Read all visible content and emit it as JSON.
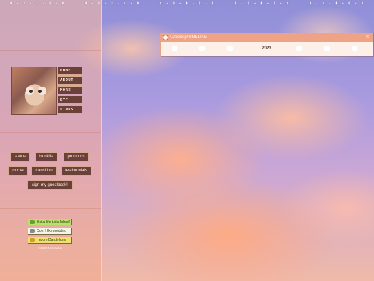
{
  "top_strip": {
    "glyphs": "✦ ⋆ ✧ ⋆ ✦ ⋆ ✧ ⋆ ✦"
  },
  "sidebar": {
    "nav": [
      {
        "label": "HOME"
      },
      {
        "label": "ABOUT"
      },
      {
        "label": "MORE"
      },
      {
        "label": "BYF"
      },
      {
        "label": "LINKS"
      }
    ],
    "pills": {
      "status": "status",
      "blocklist": "blocklist",
      "pronouns": "pronouns",
      "journal": "journal",
      "transition": "transition",
      "testimonials": "testimonials",
      "guestbook": "sign my guestbook!"
    },
    "badges": [
      {
        "text": "Enjoy life to its fullest!",
        "bg": "#b9e06a",
        "icon": "#6aa030"
      },
      {
        "text": "Ooh, I like modding",
        "bg": "#f4f4e8",
        "icon": "#8a8a8a"
      },
      {
        "text": "I adore Dandelions!",
        "bg": "#f0e070",
        "icon": "#d0a020"
      }
    ],
    "copyright": "©2023 Nebraska"
  },
  "window": {
    "title": "\\Desktop\\TIMELINE",
    "close": "×",
    "year": "2023"
  },
  "colors": {
    "accent": "#eea387",
    "button": "#6a4038",
    "sidebar": "#f5b49a"
  }
}
